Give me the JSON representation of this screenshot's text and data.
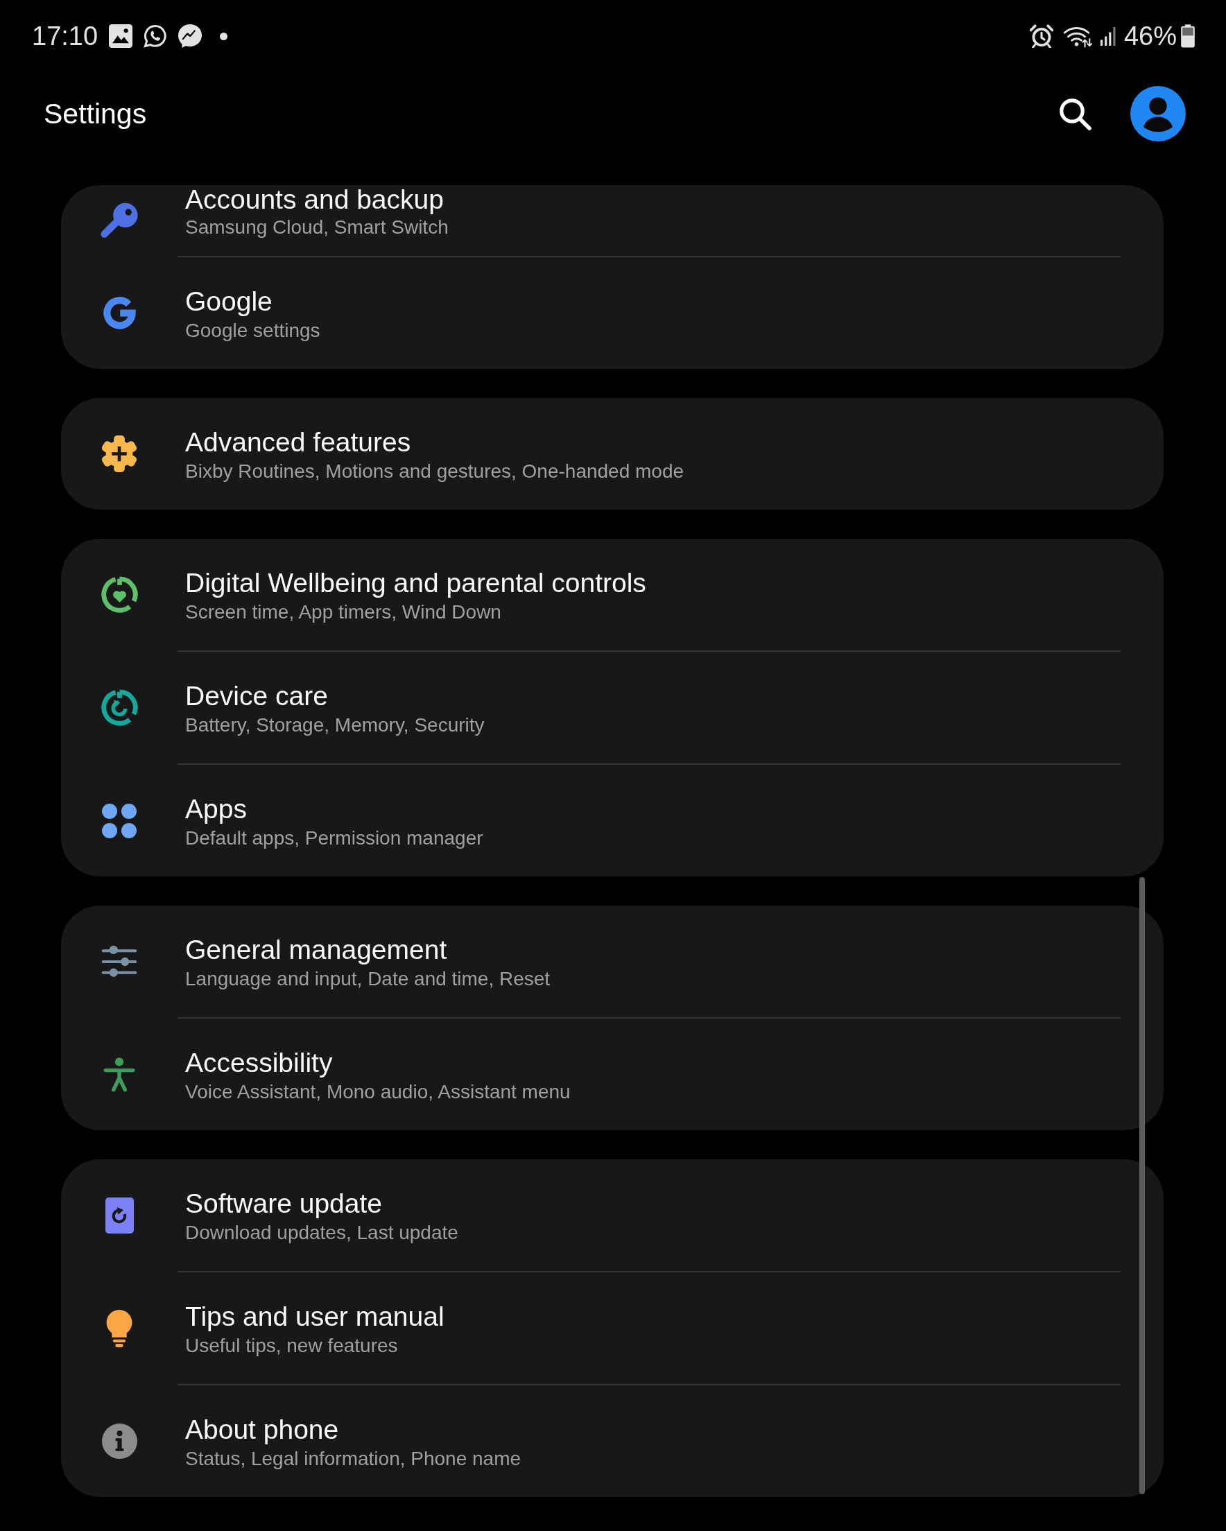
{
  "status_bar": {
    "time": "17:10",
    "battery": "46%"
  },
  "app_bar": {
    "title": "Settings"
  },
  "groups": [
    {
      "items": [
        {
          "title": "Accounts and backup",
          "subtitle": "Samsung Cloud, Smart Switch"
        },
        {
          "title": "Google",
          "subtitle": "Google settings"
        }
      ]
    },
    {
      "items": [
        {
          "title": "Advanced features",
          "subtitle": "Bixby Routines, Motions and gestures, One-handed mode"
        }
      ]
    },
    {
      "items": [
        {
          "title": "Digital Wellbeing and parental controls",
          "subtitle": "Screen time, App timers, Wind Down"
        },
        {
          "title": "Device care",
          "subtitle": "Battery, Storage, Memory, Security"
        },
        {
          "title": "Apps",
          "subtitle": "Default apps, Permission manager"
        }
      ]
    },
    {
      "items": [
        {
          "title": "General management",
          "subtitle": "Language and input, Date and time, Reset"
        },
        {
          "title": "Accessibility",
          "subtitle": "Voice Assistant, Mono audio, Assistant menu"
        }
      ]
    },
    {
      "items": [
        {
          "title": "Software update",
          "subtitle": "Download updates, Last update"
        },
        {
          "title": "Tips and user manual",
          "subtitle": "Useful tips, new features"
        },
        {
          "title": "About phone",
          "subtitle": "Status, Legal information, Phone name"
        }
      ]
    }
  ]
}
